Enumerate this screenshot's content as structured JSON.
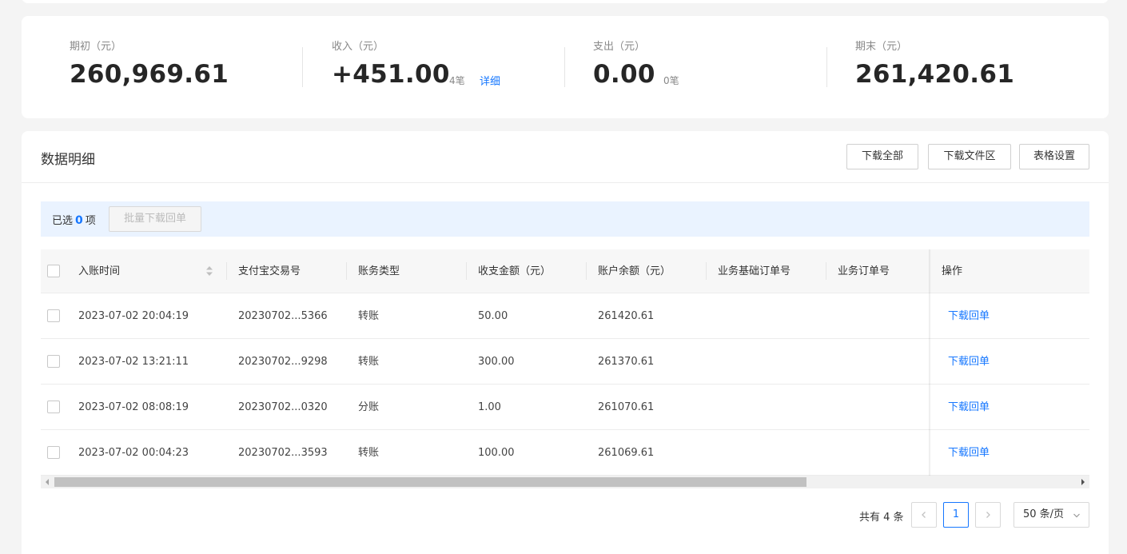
{
  "summary": {
    "opening": {
      "label": "期初（元）",
      "value": "260,969.61"
    },
    "income": {
      "label": "收入（元）",
      "value": "+451.00",
      "count": "4笔",
      "detail_link": "详细"
    },
    "expense": {
      "label": "支出（元）",
      "value": "0.00",
      "count": "0笔"
    },
    "closing": {
      "label": "期末（元）",
      "value": "261,420.61"
    }
  },
  "detail": {
    "title": "数据明细",
    "buttons": {
      "download_all": "下载全部",
      "download_files": "下载文件区",
      "table_settings": "表格设置"
    },
    "selection": {
      "prefix": "已选",
      "count": "0",
      "suffix": "项",
      "batch_button": "批量下载回单"
    },
    "columns": [
      "入账时间",
      "支付宝交易号",
      "账务类型",
      "收支金额（元）",
      "账户余额（元）",
      "业务基础订单号",
      "业务订单号",
      "操作"
    ],
    "rows": [
      {
        "time": "2023-07-02 20:04:19",
        "trade_no": "20230702...5366",
        "type": "转账",
        "amount": "50.00",
        "balance": "261420.61",
        "action": "下载回单"
      },
      {
        "time": "2023-07-02 13:21:11",
        "trade_no": "20230702...9298",
        "type": "转账",
        "amount": "300.00",
        "balance": "261370.61",
        "action": "下载回单"
      },
      {
        "time": "2023-07-02 08:08:19",
        "trade_no": "20230702...0320",
        "type": "分账",
        "amount": "1.00",
        "balance": "261070.61",
        "action": "下载回单"
      },
      {
        "time": "2023-07-02 00:04:23",
        "trade_no": "20230702...3593",
        "type": "转账",
        "amount": "100.00",
        "balance": "261069.61",
        "action": "下载回单"
      }
    ],
    "pagination": {
      "total": "共有 4 条",
      "current_page": "1",
      "page_size": "50 条/页"
    }
  },
  "colors": {
    "accent": "#1677ff",
    "selection_bar": "#eaf3ff"
  }
}
